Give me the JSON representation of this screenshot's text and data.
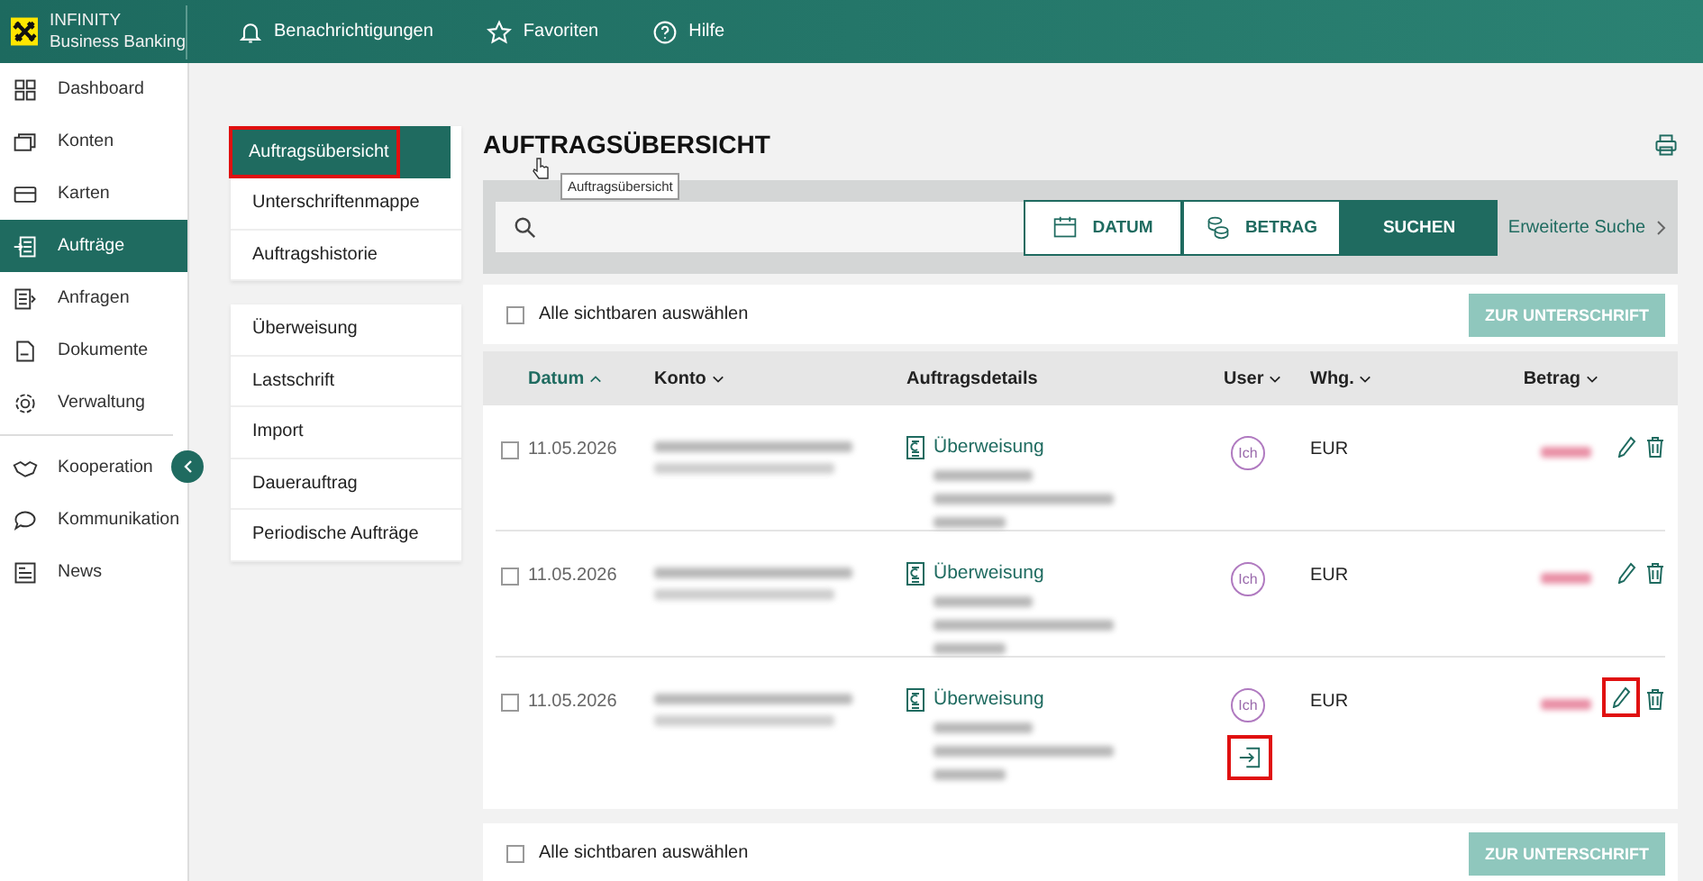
{
  "brand": {
    "line1": "INFINITY",
    "line2": "Business Banking"
  },
  "topnav": [
    {
      "kind": "bell",
      "label": "Benachrichtigungen"
    },
    {
      "kind": "star",
      "label": "Favoriten"
    },
    {
      "kind": "help",
      "label": "Hilfe"
    }
  ],
  "sidebar": {
    "groups": [
      [
        {
          "kind": "grid",
          "label": "Dashboard",
          "selected": false
        },
        {
          "kind": "cards",
          "label": "Konten",
          "selected": false
        },
        {
          "kind": "card",
          "label": "Karten",
          "selected": false
        },
        {
          "kind": "orders",
          "label": "Aufträge",
          "selected": true
        },
        {
          "kind": "requests",
          "label": "Anfragen",
          "selected": false
        },
        {
          "kind": "doc",
          "label": "Dokumente",
          "selected": false
        },
        {
          "kind": "gear",
          "label": "Verwaltung",
          "selected": false
        }
      ],
      [
        {
          "kind": "hands",
          "label": "Kooperation",
          "selected": false
        },
        {
          "kind": "chat",
          "label": "Kommunikation",
          "selected": false
        },
        {
          "kind": "news",
          "label": "News",
          "selected": false
        }
      ]
    ]
  },
  "submenu": {
    "groups": [
      [
        {
          "label": "Auftragsübersicht",
          "selected": true,
          "highlighted": true
        },
        {
          "label": "Unterschriftenmappe",
          "selected": false,
          "highlighted": false
        },
        {
          "label": "Auftragshistorie",
          "selected": false,
          "highlighted": false
        }
      ],
      [
        {
          "label": "Überweisung",
          "selected": false,
          "highlighted": false
        },
        {
          "label": "Lastschrift",
          "selected": false,
          "highlighted": false
        },
        {
          "label": "Import",
          "selected": false,
          "highlighted": false
        },
        {
          "label": "Dauerauftrag",
          "selected": false,
          "highlighted": false
        },
        {
          "label": "Periodische Aufträge",
          "selected": false,
          "highlighted": false
        }
      ]
    ]
  },
  "tooltip": "Auftragsübersicht",
  "title": "AUFTRAGSÜBERSICHT",
  "search": {
    "date_button": "DATUM",
    "amount_button": "BETRAG",
    "search_button": "SUCHEN",
    "advanced_link": "Erweiterte Suche"
  },
  "select_bar_top": {
    "label": "Alle sichtbaren auswählen",
    "checked": false,
    "button": "ZUR UNTERSCHRIFT"
  },
  "table": {
    "columns": [
      {
        "label": "Datum",
        "sortable": true,
        "ascending": true,
        "selected": true
      },
      {
        "label": "Konto",
        "sortable": true,
        "ascending": false,
        "selected": false
      },
      {
        "label": "Auftragsdetails",
        "sortable": false,
        "selected": false
      },
      {
        "label": "User",
        "sortable": true,
        "ascending": false,
        "selected": false
      },
      {
        "label": "Whg.",
        "sortable": true,
        "ascending": false,
        "selected": false
      },
      {
        "label": "Betrag",
        "sortable": true,
        "ascending": false,
        "selected": false
      }
    ],
    "rows": [
      {
        "checked": false,
        "date": "11.05.2026",
        "type": "Überweisung",
        "user": "Ich",
        "currency": "EUR",
        "import_icon": false,
        "edit_highlighted": false
      },
      {
        "checked": false,
        "date": "11.05.2026",
        "type": "Überweisung",
        "user": "Ich",
        "currency": "EUR",
        "import_icon": false,
        "edit_highlighted": false
      },
      {
        "checked": false,
        "date": "11.05.2026",
        "type": "Überweisung",
        "user": "Ich",
        "currency": "EUR",
        "import_icon": true,
        "edit_highlighted": true
      }
    ]
  },
  "select_bar_bottom": {
    "label": "Alle sichtbaren auswählen",
    "checked": false,
    "button": "ZUR UNTERSCHRIFT"
  }
}
